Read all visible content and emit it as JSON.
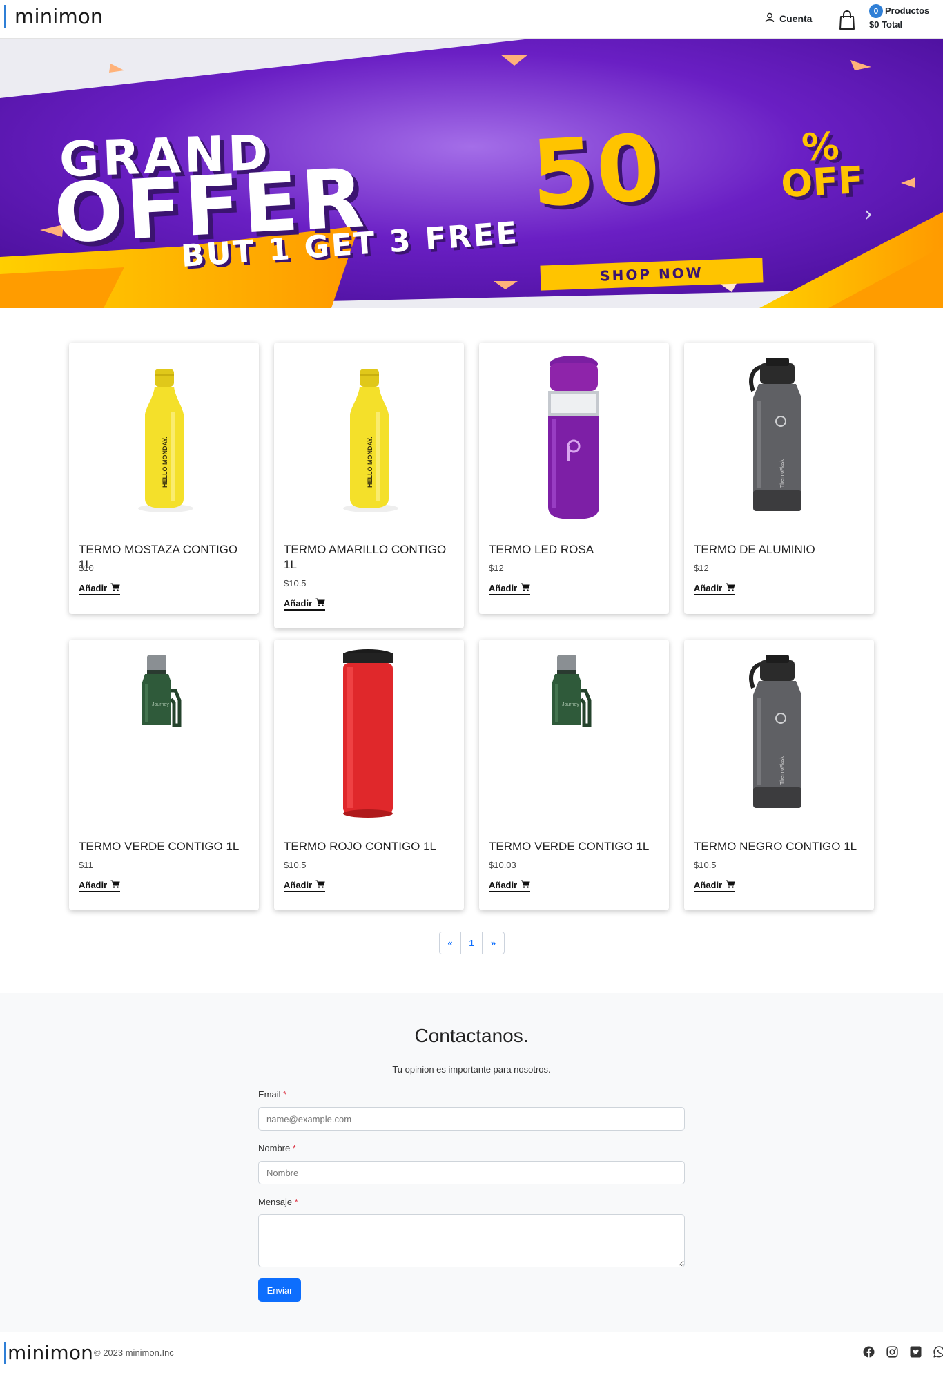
{
  "header": {
    "logo": "minimon",
    "account_label": "Cuenta",
    "cart_count": "0",
    "cart_products_label": "Productos",
    "cart_total": "$0 Total"
  },
  "banner": {
    "line1": "GRAND",
    "line2": "OFFER",
    "percent": "50",
    "percent_sign": "%",
    "off": "OFF",
    "subline": "BUT 1 GET 3 FREE",
    "cta": "SHOP NOW",
    "next_icon": "›",
    "slides": 3,
    "active_slide": 2
  },
  "products": [
    {
      "name": "TERMO MOSTAZA CONTIGO 1L",
      "price": "$10",
      "add": "Añadir",
      "image": "yellow-bottle"
    },
    {
      "name": "TERMO AMARILLO CONTIGO 1L",
      "price": "$10.5",
      "add": "Añadir",
      "image": "yellow-bottle"
    },
    {
      "name": "TERMO LED ROSA",
      "price": "$12",
      "add": "Añadir",
      "image": "purple-bottle"
    },
    {
      "name": "TERMO DE ALUMINIO",
      "price": "$12",
      "add": "Añadir",
      "image": "gray-bottle"
    },
    {
      "name": "TERMO VERDE CONTIGO 1L",
      "price": "$11",
      "add": "Añadir",
      "image": "green-flask"
    },
    {
      "name": "TERMO ROJO CONTIGO 1L",
      "price": "$10.5",
      "add": "Añadir",
      "image": "red-bottle"
    },
    {
      "name": "TERMO VERDE CONTIGO 1L",
      "price": "$10.03",
      "add": "Añadir",
      "image": "green-flask"
    },
    {
      "name": "TERMO NEGRO CONTIGO 1L",
      "price": "$10.5",
      "add": "Añadir",
      "image": "gray-bottle"
    }
  ],
  "pagination": {
    "prev": "«",
    "current": "1",
    "next": "»"
  },
  "contact": {
    "title": "Contactanos.",
    "subtitle": "Tu opinion es importante para nosotros.",
    "email_label": "Email",
    "email_placeholder": "name@example.com",
    "name_label": "Nombre",
    "name_placeholder": "Nombre",
    "message_label": "Mensaje",
    "required_mark": "*",
    "submit": "Enviar"
  },
  "footer": {
    "logo": "minimon",
    "copyright": "© 2023 minimon.Inc",
    "socials": [
      "facebook-icon",
      "instagram-icon",
      "twitter-icon",
      "whatsapp-icon"
    ]
  },
  "colors": {
    "accent": "#2f7fd6",
    "primary_button": "#0d6efd",
    "banner_purple": "#6a1fc4",
    "banner_yellow": "#ffc400"
  }
}
